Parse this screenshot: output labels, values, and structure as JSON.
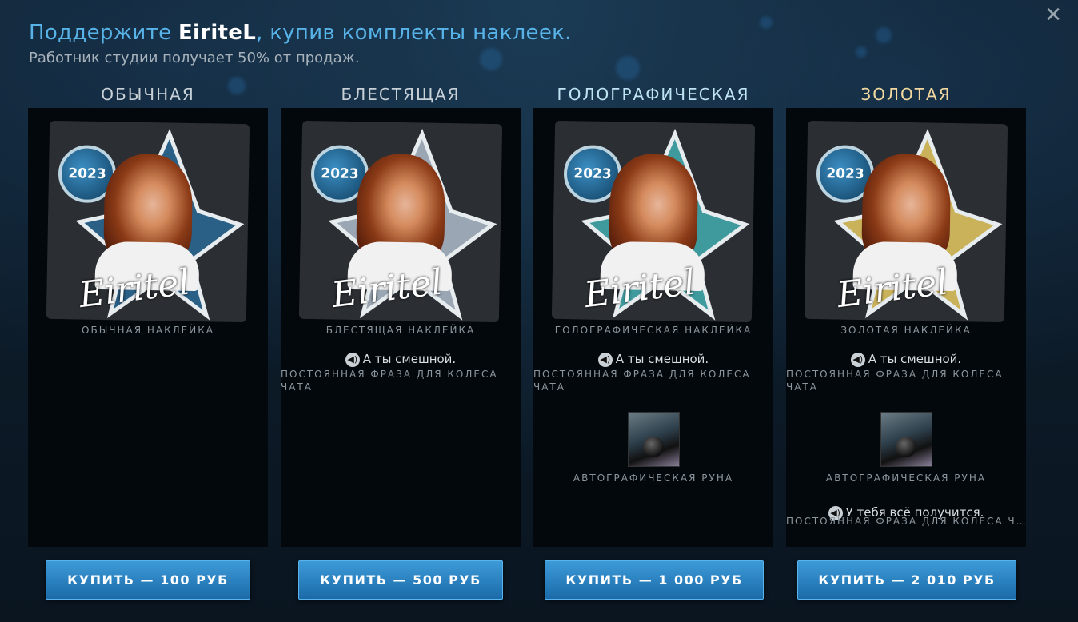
{
  "header": {
    "title_prefix": "Поддержите ",
    "title_name": "EiriteL",
    "title_suffix": ", купив комплекты наклеек.",
    "subtitle": "Работник студии получает 50% от продаж."
  },
  "close_icon": "close-icon",
  "tiers": [
    {
      "header": "ОБЫЧНАЯ",
      "sticker_label": "ОБЫЧНАЯ НАКЛЕЙКА",
      "badge_year": "2023",
      "signature": "Eiritel",
      "buy_label": "КУПИТЬ — 100 РУБ",
      "accent": "#2a5f86"
    },
    {
      "header": "БЛЕСТЯЩАЯ",
      "sticker_label": "БЛЕСТЯЩАЯ НАКЛЕЙКА",
      "badge_year": "2023",
      "signature": "Eiritel",
      "phrase": "А ты смешной.",
      "phrase_desc": "ПОСТОЯННАЯ ФРАЗА ДЛЯ КОЛЕСА ЧАТА",
      "buy_label": "КУПИТЬ — 500 РУБ",
      "accent": "#9aa6b3"
    },
    {
      "header": "ГОЛОГРАФИЧЕСКАЯ",
      "sticker_label": "ГОЛОГРАФИЧЕСКАЯ НАКЛЕЙКА",
      "badge_year": "2023",
      "signature": "Eiritel",
      "phrase": "А ты смешной.",
      "phrase_desc": "ПОСТОЯННАЯ ФРАЗА ДЛЯ КОЛЕСА ЧАТА",
      "rune_label": "АВТОГРАФИЧЕСКАЯ РУНА",
      "buy_label": "КУПИТЬ — 1 000 РУБ",
      "accent": "#3f9a9e"
    },
    {
      "header": "ЗОЛОТАЯ",
      "sticker_label": "ЗОЛОТАЯ НАКЛЕЙКА",
      "badge_year": "2023",
      "signature": "Eiritel",
      "phrase": "А ты смешной.",
      "phrase_desc": "ПОСТОЯННАЯ ФРАЗА ДЛЯ КОЛЕСА ЧАТА",
      "rune_label": "АВТОГРАФИЧЕСКАЯ РУНА",
      "phrase2": "У тебя всё получится.",
      "phrase2_desc": "ПОСТОЯННАЯ ФРАЗА ДЛЯ КОЛЕСА Ч…",
      "buy_label": "КУПИТЬ — 2 010 РУБ",
      "accent": "#c9b25a"
    }
  ]
}
